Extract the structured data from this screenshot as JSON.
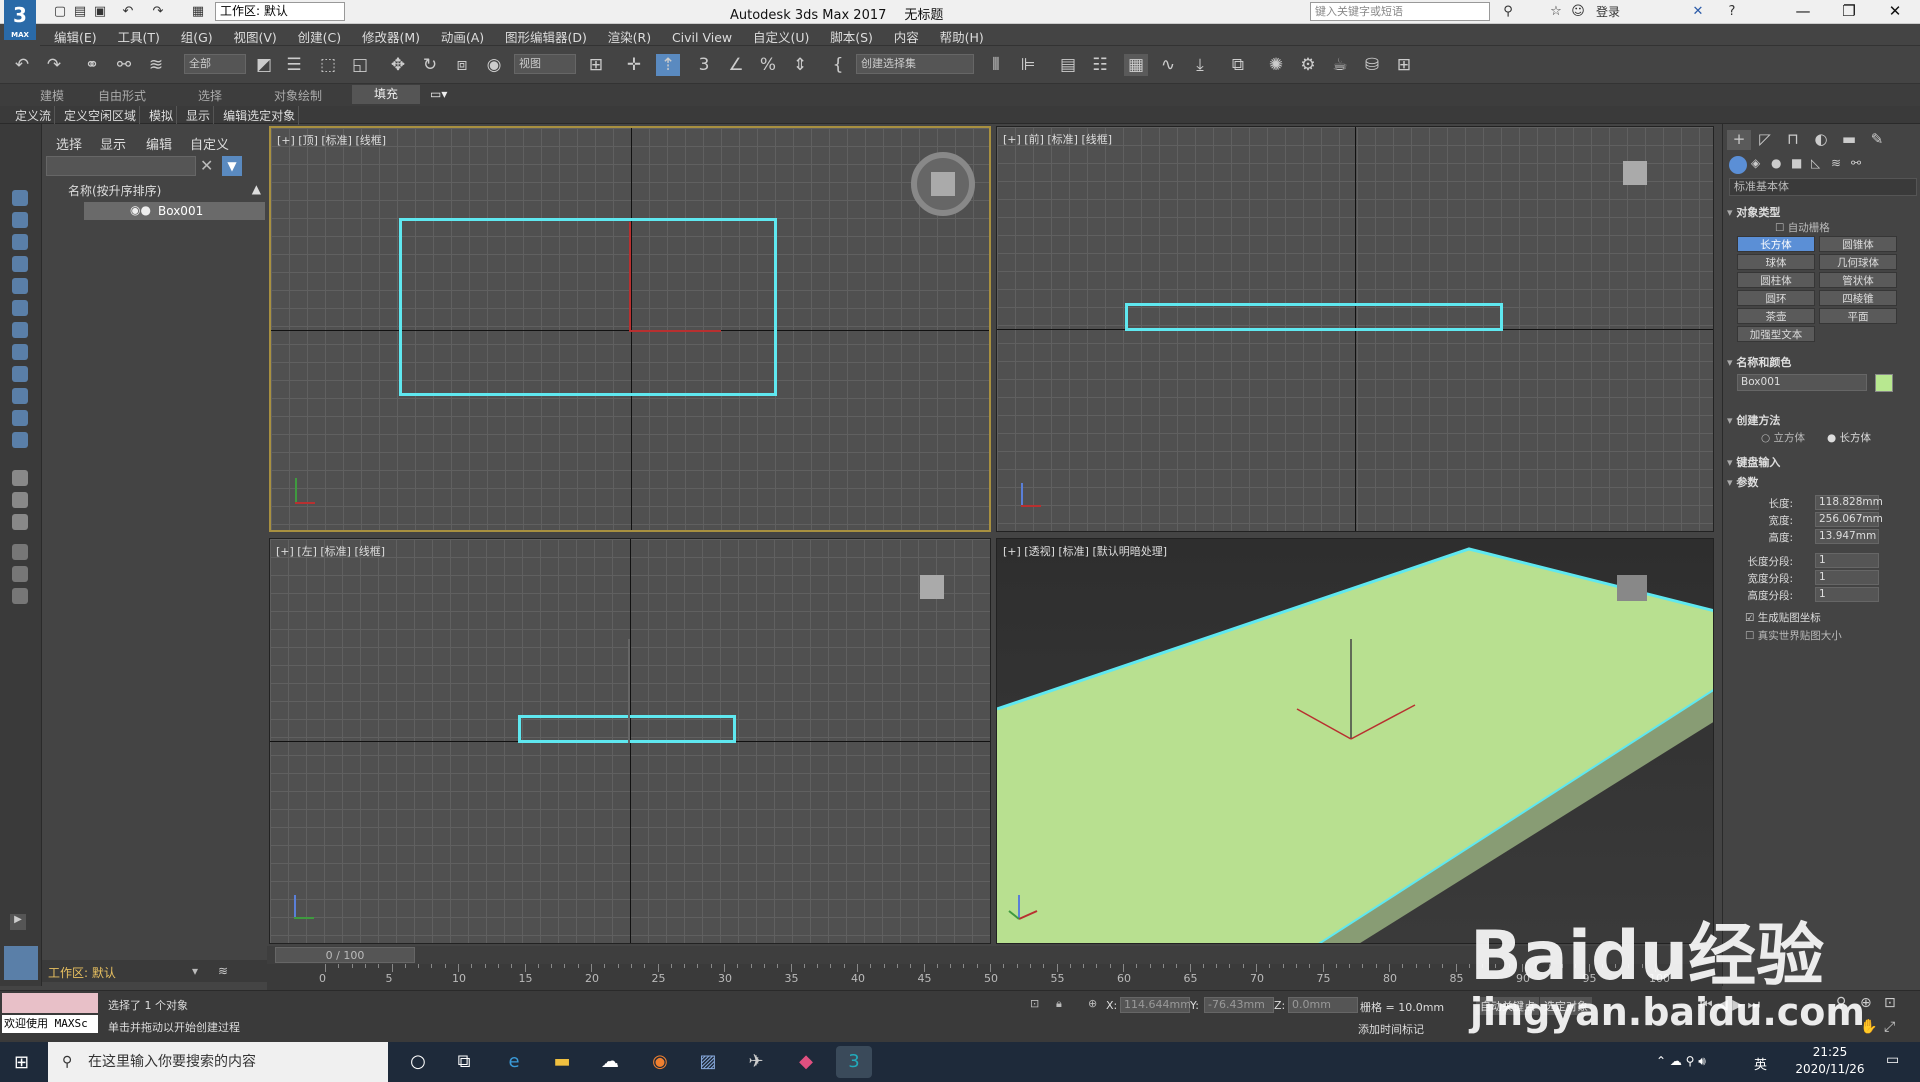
{
  "app": {
    "title": "Autodesk 3ds Max 2017",
    "doc": "无标题",
    "logo": "3",
    "logo_sub": "MAX",
    "workspace": "工作区: 默认",
    "search_placeholder": "键入关键字或短语",
    "login": "登录"
  },
  "menu": [
    "编辑(E)",
    "工具(T)",
    "组(G)",
    "视图(V)",
    "创建(C)",
    "修改器(M)",
    "动画(A)",
    "图形编辑器(D)",
    "渲染(R)",
    "Civil View",
    "自定义(U)",
    "脚本(S)",
    "内容",
    "帮助(H)"
  ],
  "toolbar": {
    "filter": "全部",
    "refcoord": "视图",
    "selset": "创建选择集"
  },
  "ribbon": {
    "tabs": [
      "建模",
      "自由形式",
      "选择",
      "对象绘制",
      "填充"
    ],
    "active": "填充",
    "sub": [
      "定义流",
      "定义空闲区域",
      "模拟",
      "显示",
      "编辑选定对象"
    ]
  },
  "explorer": {
    "tabs": [
      "选择",
      "显示",
      "编辑",
      "自定义"
    ],
    "header": "名称(按升序排序)",
    "row": "Box001",
    "workspace": "工作区: 默认"
  },
  "viewports": [
    {
      "label": "[+] [顶] [标准] [线框]"
    },
    {
      "label": "[+] [前] [标准] [线框]"
    },
    {
      "label": "[+] [左] [标准] [线框]"
    },
    {
      "label": "[+] [透视] [标准] [默认明暗处理]"
    }
  ],
  "cmd": {
    "dropdown": "标准基本体",
    "sec_objtype": "对象类型",
    "autogrid": "自动栅格",
    "buttons": [
      "长方体",
      "圆锥体",
      "球体",
      "几何球体",
      "圆柱体",
      "管状体",
      "圆环",
      "四棱锥",
      "茶壶",
      "平面",
      "加强型文本"
    ],
    "sec_namecolor": "名称和颜色",
    "name": "Box001",
    "color": "#b8e890",
    "sec_method": "创建方法",
    "method_cube": "立方体",
    "method_box": "长方体",
    "sec_keyboard": "键盘输入",
    "sec_params": "参数",
    "params": [
      {
        "label": "长度:",
        "value": "118.828mm"
      },
      {
        "label": "宽度:",
        "value": "256.067mm"
      },
      {
        "label": "高度:",
        "value": "13.947mm"
      },
      {
        "label": "长度分段:",
        "value": "1"
      },
      {
        "label": "宽度分段:",
        "value": "1"
      },
      {
        "label": "高度分段:",
        "value": "1"
      }
    ],
    "genmap": "生成贴图坐标",
    "realworld": "真实世界贴图大小"
  },
  "timeline": {
    "slider": "0 / 100",
    "ticks": [
      "0",
      "5",
      "10",
      "15",
      "20",
      "25",
      "30",
      "35",
      "40",
      "45",
      "50",
      "55",
      "60",
      "65",
      "70",
      "75",
      "80",
      "85",
      "90",
      "95",
      "100"
    ]
  },
  "status": {
    "maxscript": "欢迎使用 MAXSc",
    "msg1": "选择了 1 个对象",
    "msg2": "单击并拖动以开始创建过程",
    "x_label": "X:",
    "x": "114.644mm",
    "y_label": "Y:",
    "y": "-76.43mm",
    "z_label": "Z:",
    "z": "0.0mm",
    "grid": "栅格 = 10.0mm",
    "addtime": "添加时间标记",
    "autokey": "自动关键点",
    "selobj": "选定对象"
  },
  "taskbar": {
    "search": "在这里输入你要搜索的内容",
    "time": "21:25",
    "date": "2020/11/26",
    "lang": "英"
  },
  "watermark": {
    "brand": "Baidu经验",
    "url": "jingyan.baidu.com"
  }
}
